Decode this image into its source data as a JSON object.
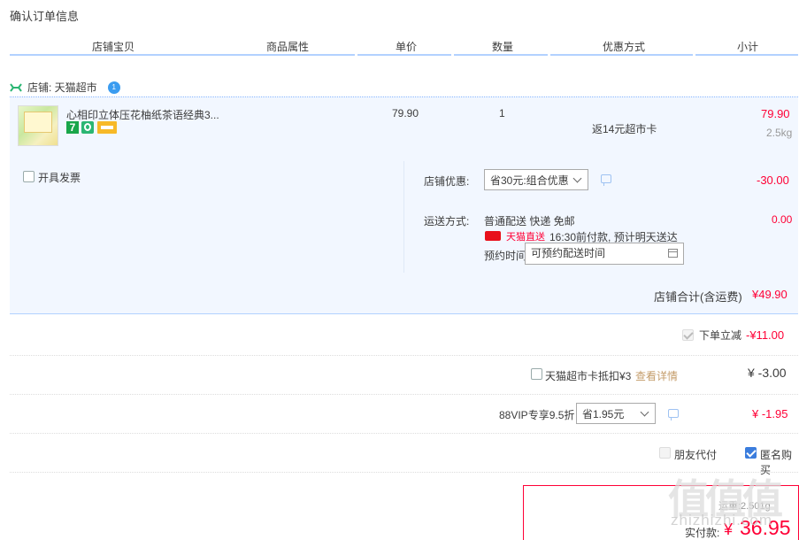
{
  "page_title": "确认订单信息",
  "columns": [
    "店铺宝贝",
    "商品属性",
    "单价",
    "数量",
    "优惠方式",
    "小计"
  ],
  "shop": {
    "label": "店铺: 天猫超市",
    "contact_icon": "wangwang-icon",
    "contact_text": "1"
  },
  "item": {
    "title": "心相印立体压花柚纸茶语经典3...",
    "badge_7": "7",
    "price": "79.90",
    "quantity": "1",
    "discount": "返14元超市卡",
    "subtotal": "79.90",
    "weight": "2.5kg"
  },
  "invoice_label": "开具发票",
  "shop_discount": {
    "label": "店铺优惠:",
    "selected": "省30元:组合优惠",
    "amount": "-30.00"
  },
  "shipping": {
    "label": "运送方式:",
    "method": "普通配送 快递 免邮",
    "tmall_tag": "天猫直送",
    "eta": "16:30前付款, 预计明天送达",
    "amount": "0.00",
    "reserve_label": "预约时间",
    "reserve_placeholder": "可预约配送时间"
  },
  "shop_total": {
    "label": "店铺合计(含运费)",
    "amount": "¥49.90"
  },
  "instant_discount": {
    "label": "下单立减",
    "amount": "-¥11.00"
  },
  "supermarket_card": {
    "label": "天猫超市卡抵扣¥3",
    "link": "查看详情",
    "amount": "¥ -3.00"
  },
  "vip": {
    "label": "88VIP专享9.5折",
    "selected": "省1.95元",
    "amount": "¥ -1.95"
  },
  "friend_pay_label": "朋友代付",
  "anonymous_label": "匿名购买",
  "payment": {
    "weight_text": "运重:2.501g",
    "label": "实付款:",
    "currency": "¥",
    "amount": "36.95"
  },
  "watermark": {
    "logo": "值值值",
    "domain": "zhizhizhi.com"
  },
  "colors": {
    "price_red": "#ff0036",
    "panel_blue": "#f2f7ff",
    "accent_blue": "#3b7ddd"
  }
}
